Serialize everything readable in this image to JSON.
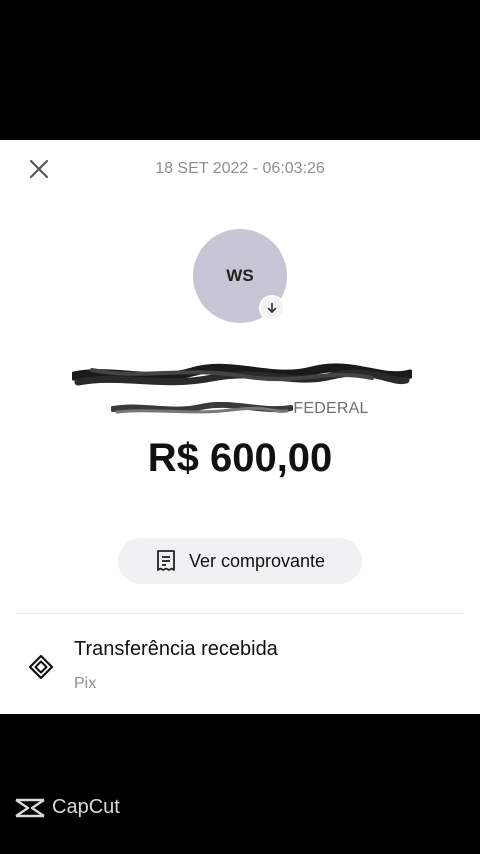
{
  "transaction": {
    "timestamp": "18 SET 2022 - 06:03:26",
    "avatar_initials": "WS",
    "bank_visible_text": "FEDERAL",
    "amount": "R$ 600,00",
    "receipt_button_label": "Ver comprovante",
    "type_title": "Transferência recebida",
    "type_subtitle": "Pix"
  },
  "icons": {
    "close": "close-icon",
    "avatar_badge": "arrow-down-icon",
    "receipt": "receipt-icon",
    "pix": "pix-icon",
    "watermark": "capcut-logo"
  },
  "watermark": {
    "label": "CapCut"
  },
  "colors": {
    "background": "#000000",
    "card": "#ffffff",
    "avatar": "#c7c6d4",
    "button_bg": "#f1f1f3",
    "muted_text": "#8e8e93"
  }
}
